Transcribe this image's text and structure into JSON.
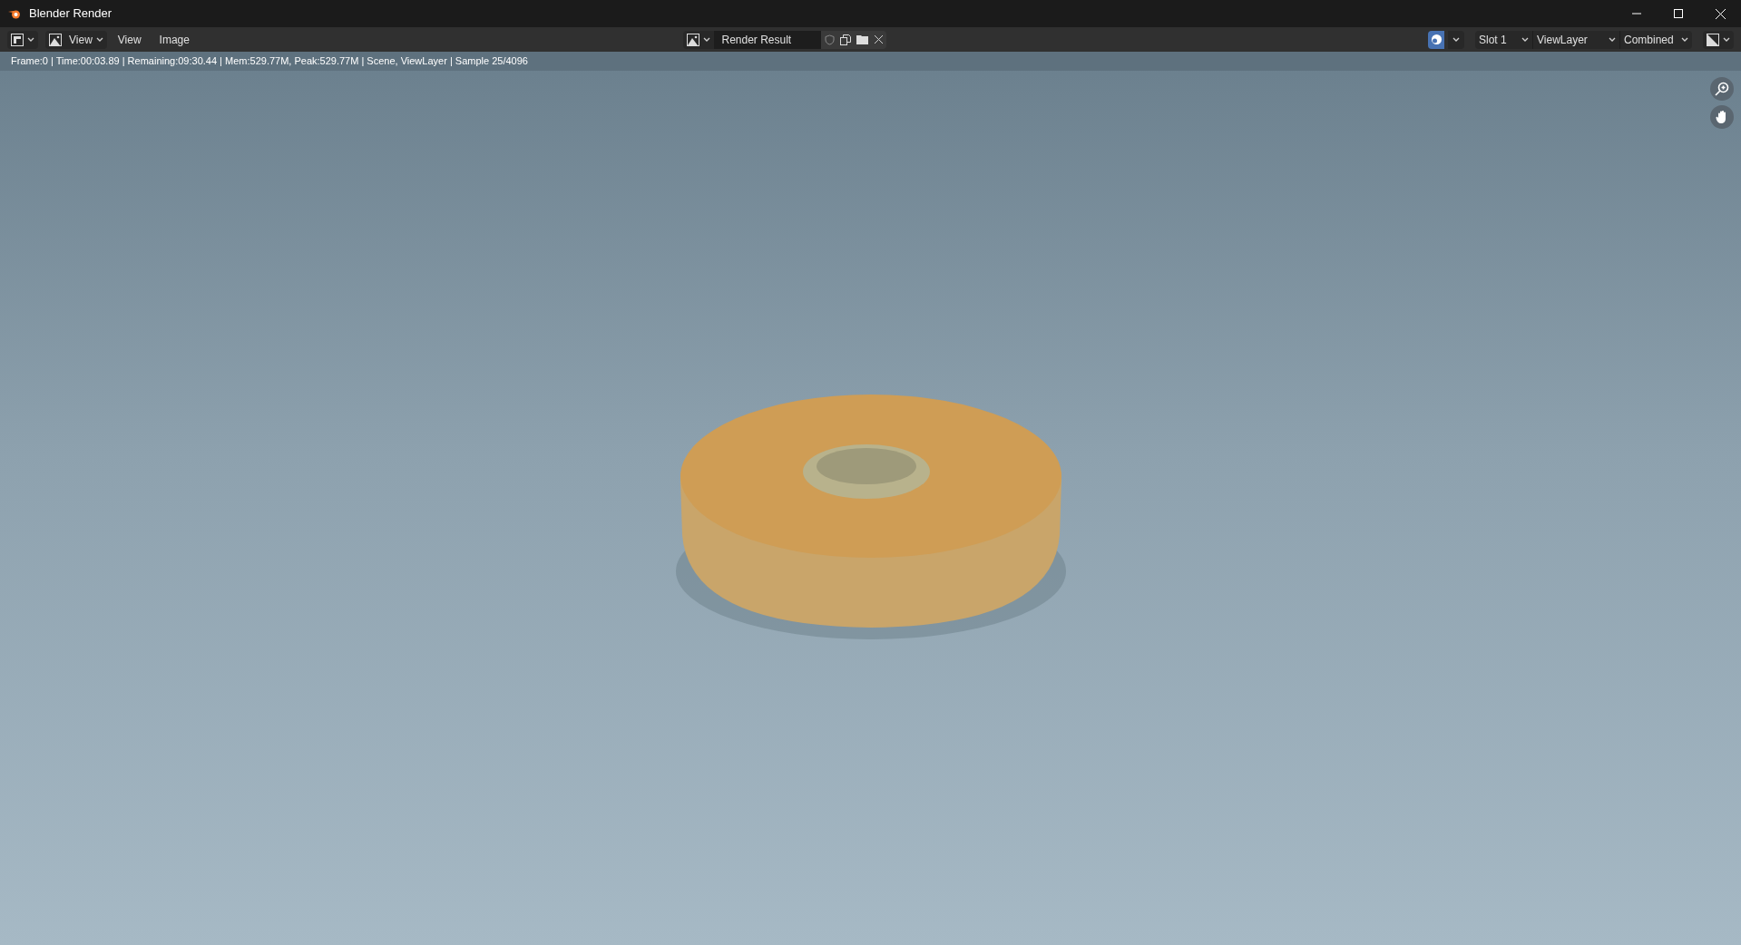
{
  "window": {
    "title": "Blender Render"
  },
  "header": {
    "view_dropdown": "View",
    "menus": [
      "View",
      "Image"
    ],
    "image_name": "Render Result",
    "slot": "Slot 1",
    "view_layer": "ViewLayer",
    "pass": "Combined"
  },
  "info": "Frame:0 | Time:00:03.89 | Remaining:09:30.44 | Mem:529.77M, Peak:529.77M | Scene, ViewLayer | Sample 25/4096"
}
